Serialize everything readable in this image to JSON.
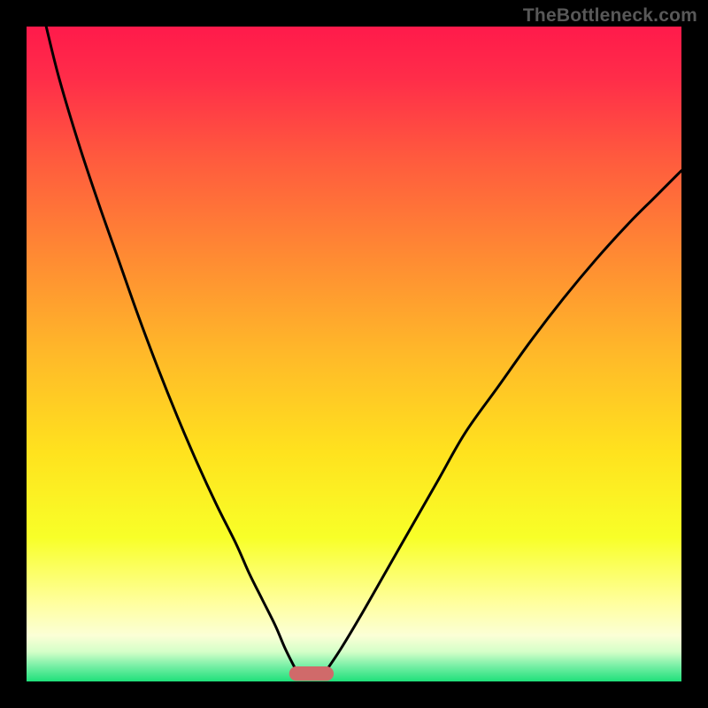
{
  "watermark": "TheBottleneck.com",
  "chart_data": {
    "type": "line",
    "title": "",
    "xlabel": "",
    "ylabel": "",
    "xlim": [
      0,
      100
    ],
    "ylim": [
      0,
      100
    ],
    "background_gradient": {
      "stops": [
        {
          "offset": 0.0,
          "color": "#ff1a4b"
        },
        {
          "offset": 0.08,
          "color": "#ff2d49"
        },
        {
          "offset": 0.2,
          "color": "#ff5a3e"
        },
        {
          "offset": 0.35,
          "color": "#ff8a33"
        },
        {
          "offset": 0.5,
          "color": "#ffb929"
        },
        {
          "offset": 0.65,
          "color": "#ffe21e"
        },
        {
          "offset": 0.78,
          "color": "#f8ff28"
        },
        {
          "offset": 0.88,
          "color": "#ffff9e"
        },
        {
          "offset": 0.93,
          "color": "#fbffd6"
        },
        {
          "offset": 0.955,
          "color": "#d4ffc8"
        },
        {
          "offset": 0.975,
          "color": "#7df0a8"
        },
        {
          "offset": 1.0,
          "color": "#1fe07a"
        }
      ]
    },
    "series": [
      {
        "name": "left-curve",
        "x": [
          3,
          5,
          8,
          11,
          14,
          17,
          20,
          23,
          26,
          29,
          32,
          34,
          36,
          38,
          39.5,
          41
        ],
        "y": [
          100,
          92,
          82,
          73,
          64.5,
          56,
          48,
          40.5,
          33.5,
          27,
          21,
          16.5,
          12.5,
          8.5,
          5,
          2
        ]
      },
      {
        "name": "right-curve",
        "x": [
          46,
          48,
          51,
          55,
          59,
          63,
          67,
          72,
          77,
          82,
          87,
          92,
          96,
          100
        ],
        "y": [
          2,
          5,
          10,
          17,
          24,
          31,
          38,
          45,
          52,
          58.5,
          64.5,
          70,
          74,
          78
        ]
      }
    ],
    "marker": {
      "name": "bottom-marker",
      "cx": 43.5,
      "cy": 1.2,
      "rx": 3.4,
      "ry": 1.1,
      "color": "#d06a6a"
    }
  }
}
